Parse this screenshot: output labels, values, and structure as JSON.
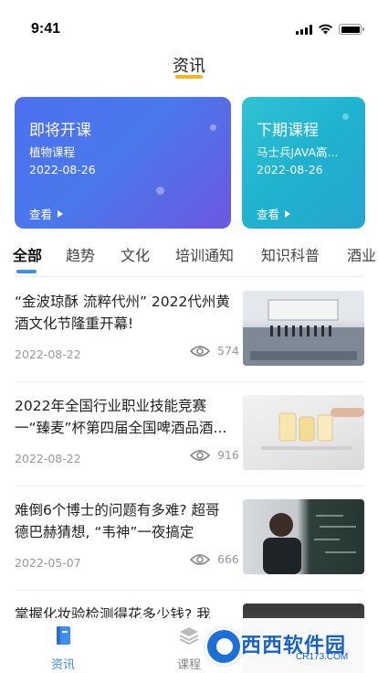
{
  "status_bar": {
    "time": "9:41"
  },
  "header": {
    "title": "资讯"
  },
  "cards": [
    {
      "title": "即将开课",
      "subtitle": "植物课程",
      "date": "2022-08-26",
      "link": "查看"
    },
    {
      "title": "下期课程",
      "subtitle": "马士兵JAVA高...",
      "date": "2022-08-26",
      "link": "查看"
    }
  ],
  "tabs": [
    {
      "label": "全部",
      "active": true
    },
    {
      "label": "趋势"
    },
    {
      "label": "文化"
    },
    {
      "label": "培训通知"
    },
    {
      "label": "知识科普"
    },
    {
      "label": "酒业"
    }
  ],
  "news": [
    {
      "title": "“金波琼酥 流粹代州” 2022代州黄酒文化节隆重开幕!",
      "date": "2022-08-22",
      "views": "574"
    },
    {
      "title": "2022年全国行业职业技能竞赛一“臻麦”杯第四届全国啤酒品酒...",
      "date": "2022-08-22",
      "views": "916"
    },
    {
      "title": "难倒6个博士的问题有多难? 超哥德巴赫猜想, “韦神”一夜搞定",
      "date": "2022-05-07",
      "views": "666"
    },
    {
      "title": "掌握化妆验检测得花多少钱? 我"
    }
  ],
  "bottom_nav": [
    {
      "label": "资讯",
      "icon": "book-icon",
      "active": true
    },
    {
      "label": "课程",
      "icon": "layers-icon",
      "active": false
    }
  ],
  "watermark": {
    "text": "西西软件园",
    "sub": "CR173.COM"
  },
  "colors": {
    "accent": "#3e8ff0",
    "title_underline": "#f5b51e",
    "card1": "#4d6ff0",
    "card2": "#1fb2d0"
  }
}
